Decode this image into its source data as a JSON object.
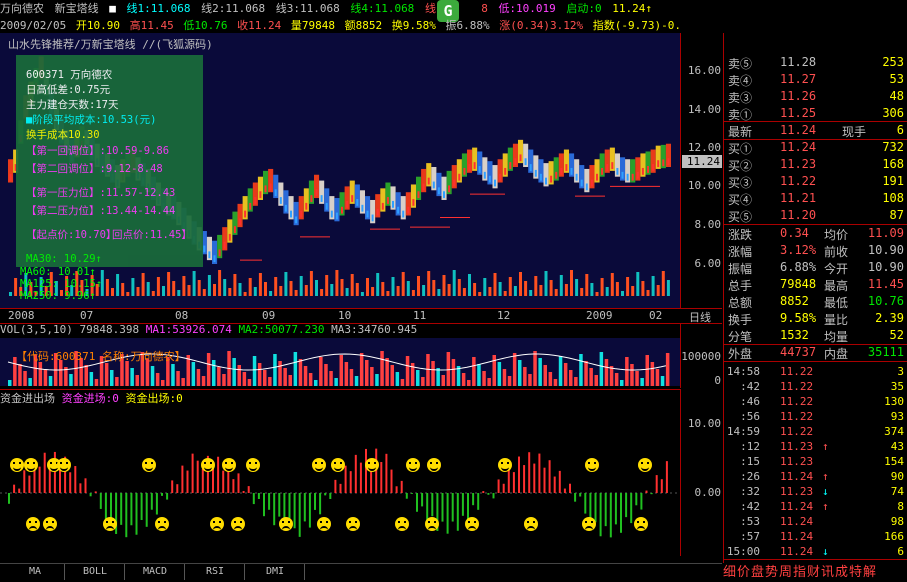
{
  "header": {
    "stock_name": "万向德农",
    "indicator": "新宝塔线",
    "line1": "线1:11.068",
    "line2": "线2:11.068",
    "line3": "线3:11.068",
    "line4": "线4:11.068",
    "line5": "线",
    "line5_tail": "8",
    "low": "低:10.019",
    "start": "启动:0",
    "start_val": "11.24↑"
  },
  "header2": {
    "date": "2009/02/05",
    "open": "开10.90",
    "high": "高11.45",
    "low": "低10.76",
    "close": "收11.24",
    "vol": "量79848",
    "amount": "额8852",
    "turnover": "换9.58%",
    "amplitude": "振6.88%",
    "change": "涨(0.34)3.12%",
    "index": "指数(-9.73)-0.46%"
  },
  "overlay_text": {
    "title": "山水先锋推荐/万新宝塔线 //(飞狐源码)"
  },
  "info_panel": {
    "code": "600371 万向德农",
    "daily_diff": "日高低差:0.75元",
    "build_days": "主力建仓天数:17天",
    "stage_cost": "■阶段平均成本:10.53(元)",
    "handover_cost": "换手成本10.30",
    "adj1": "【第一回调位】:10.59-9.86",
    "adj2": "【第二回调位】:9.12-8.48",
    "press1": "【第一压力位】:11.57-12.43",
    "press2": "【第二压力位】:13.44-14.44",
    "start_price": "【起点价:10.70】",
    "return_price": "回点价:11.45】",
    "ma30": "MA30: 10.29↑",
    "ma60": "MA60: 10.01↑",
    "ma125": "MA125: 10.15↑",
    "ma250": "MA250: 9.96↑"
  },
  "y_axis": [
    "16.00",
    "14.00",
    "12.00",
    "10.00",
    "8.00",
    "6.00"
  ],
  "current_price_tag": "11.24",
  "date_axis": [
    "2008",
    "07",
    "08",
    "09",
    "10",
    "11",
    "12",
    "2009",
    "02"
  ],
  "period_label": "日线",
  "volume": {
    "header": "VOL(3,5,10)",
    "vol": "79848.398",
    "ma1": "MA1:53926.074",
    "ma2": "MA2:50077.230",
    "ma3": "MA3:34760.945",
    "code_label": "【代码:600371  名称:万向德农】",
    "axis_top": "100000",
    "axis_bottom": "0"
  },
  "flow": {
    "title": "资金进出场",
    "in_label": "资金进场:0",
    "out_label": "资金出场:0",
    "axis_top": "10.00",
    "axis_mid": "0.00"
  },
  "tabs": [
    "MA",
    "BOLL",
    "MACD",
    "RSI",
    "DMI"
  ],
  "quote": {
    "asks": [
      {
        "label": "卖⑤",
        "price": "11.28",
        "vol": "253"
      },
      {
        "label": "卖④",
        "price": "11.27",
        "vol": "53"
      },
      {
        "label": "卖③",
        "price": "11.26",
        "vol": "48"
      },
      {
        "label": "卖①",
        "price": "11.25",
        "vol": "306"
      }
    ],
    "latest_label": "最新",
    "latest": "11.24",
    "cur_vol_label": "现手",
    "cur_vol": "6",
    "bids": [
      {
        "label": "买①",
        "price": "11.24",
        "vol": "732"
      },
      {
        "label": "买②",
        "price": "11.23",
        "vol": "168"
      },
      {
        "label": "买③",
        "price": "11.22",
        "vol": "191"
      },
      {
        "label": "买④",
        "price": "11.21",
        "vol": "108"
      },
      {
        "label": "买⑤",
        "price": "11.20",
        "vol": "87"
      }
    ],
    "stats": [
      {
        "l1": "涨跌",
        "v1": "0.34",
        "l2": "均价",
        "v2": "11.09"
      },
      {
        "l1": "涨幅",
        "v1": "3.12%",
        "l2": "前收",
        "v2": "10.90"
      },
      {
        "l1": "振幅",
        "v1": "6.88%",
        "l2": "今开",
        "v2": "10.90"
      },
      {
        "l1": "总手",
        "v1": "79848",
        "l2": "最高",
        "v2": "11.45"
      },
      {
        "l1": "总额",
        "v1": "8852",
        "l2": "最低",
        "v2": "10.76"
      },
      {
        "l1": "换手",
        "v1": "9.58%",
        "l2": "量比",
        "v2": "2.39"
      },
      {
        "l1": "分笔",
        "v1": "1532",
        "l2": "均量",
        "v2": "52"
      }
    ],
    "outer_label": "外盘",
    "outer": "44737",
    "inner_label": "内盘",
    "inner": "35111"
  },
  "ticks": [
    {
      "t": "14:58",
      "p": "11.22",
      "a": "",
      "v": "3"
    },
    {
      "t": ":42",
      "p": "11.22",
      "a": "",
      "v": "35"
    },
    {
      "t": ":46",
      "p": "11.22",
      "a": "",
      "v": "130"
    },
    {
      "t": ":56",
      "p": "11.22",
      "a": "",
      "v": "93"
    },
    {
      "t": "14:59",
      "p": "11.22",
      "a": "",
      "v": "374"
    },
    {
      "t": ":12",
      "p": "11.23",
      "a": "↑",
      "v": "43"
    },
    {
      "t": ":15",
      "p": "11.23",
      "a": "",
      "v": "154"
    },
    {
      "t": ":26",
      "p": "11.24",
      "a": "↑",
      "v": "90"
    },
    {
      "t": ":32",
      "p": "11.23",
      "a": "↓",
      "v": "74"
    },
    {
      "t": ":42",
      "p": "11.24",
      "a": "↑",
      "v": "8"
    },
    {
      "t": ":53",
      "p": "11.24",
      "a": "",
      "v": "98"
    },
    {
      "t": ":57",
      "p": "11.24",
      "a": "",
      "v": "166"
    },
    {
      "t": "15:00",
      "p": "11.24",
      "a": "↓",
      "v": "6"
    }
  ],
  "footer": {
    "tabs_right": "细价盘势周指财讯成特解"
  }
}
